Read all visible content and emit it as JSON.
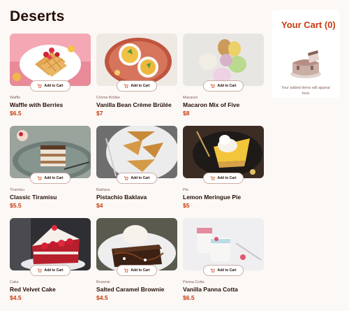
{
  "page": {
    "title": "Deserts"
  },
  "button_label": "Add to Cart",
  "cart": {
    "title": "Your Cart (0)",
    "empty_text": "Your added items will appear here"
  },
  "products": [
    {
      "category": "Waffle",
      "name": "Waffle with Berries",
      "price": "$6.5",
      "image": "waffle-berries"
    },
    {
      "category": "Crème Brûlée",
      "name": "Vanilla Bean Crème Brûlée",
      "price": "$7",
      "image": "creme-brulee"
    },
    {
      "category": "Macaron",
      "name": "Macaron Mix of Five",
      "price": "$8",
      "image": "macarons"
    },
    {
      "category": "Tiramisu",
      "name": "Classic Tiramisu",
      "price": "$5.5",
      "image": "tiramisu"
    },
    {
      "category": "Baklava",
      "name": "Pistachio Baklava",
      "price": "$4",
      "image": "baklava"
    },
    {
      "category": "Pie",
      "name": "Lemon Meringue Pie",
      "price": "$5",
      "image": "lemon-pie"
    },
    {
      "category": "Cake",
      "name": "Red Velvet Cake",
      "price": "$4.5",
      "image": "red-velvet-cake"
    },
    {
      "category": "Brownie",
      "name": "Salted Caramel Brownie",
      "price": "$4.5",
      "image": "brownie"
    },
    {
      "category": "Panna Cotta",
      "name": "Vanilla Panna Cotta",
      "price": "$6.5",
      "image": "panna-cotta"
    }
  ],
  "colors": {
    "accent": "#c73b0f",
    "text": "#260f08",
    "muted": "#87635a",
    "background": "#fcf8f5"
  }
}
